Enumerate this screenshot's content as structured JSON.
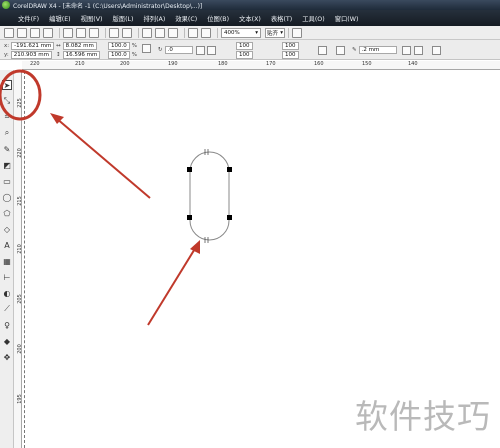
{
  "window": {
    "title": "CorelDRAW X4 - [未命名 -1 (C:\\Users\\Administrator\\Desktop\\...)]"
  },
  "menu": [
    {
      "label": "文件(F)"
    },
    {
      "label": "编辑(E)"
    },
    {
      "label": "视图(V)"
    },
    {
      "label": "版面(L)"
    },
    {
      "label": "排列(A)"
    },
    {
      "label": "效果(C)"
    },
    {
      "label": "位图(B)"
    },
    {
      "label": "文本(X)"
    },
    {
      "label": "表格(T)"
    },
    {
      "label": "工具(O)"
    },
    {
      "label": "窗口(W)"
    }
  ],
  "standard_toolbar": {
    "zoom_value": "400%",
    "snap_label": "贴齐"
  },
  "property_bar": {
    "x_label": "x:",
    "x_value": "-191.621 mm",
    "y_label": "y:",
    "y_value": "210.903 mm",
    "width_value": "8.082 mm",
    "height_value": "16.596 mm",
    "scale_w": "100.0",
    "scale_h": "100.0",
    "pct": "%",
    "rotation": ".0",
    "node1": "100",
    "node2": "100",
    "node3": "100",
    "node4": "100",
    "outline_width": ".2 mm"
  },
  "ruler_top_labels": [
    "220",
    "210",
    "200",
    "190",
    "180",
    "170",
    "160",
    "150",
    "140"
  ],
  "ruler_left_labels": [
    "225",
    "220",
    "215",
    "210",
    "205",
    "200",
    "195"
  ],
  "watermark": "软件技巧",
  "colors": {
    "annotation": "#c0392b",
    "menubar": "#1c232c",
    "selection_handle": "#000000"
  }
}
